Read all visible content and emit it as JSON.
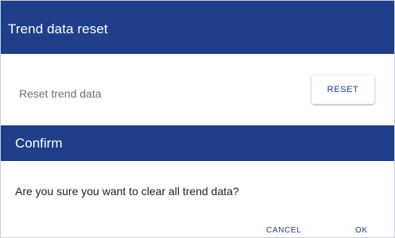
{
  "settings_panel": {
    "title": "Trend data reset",
    "row_label": "Reset trend data",
    "reset_button_label": "RESET"
  },
  "confirm_dialog": {
    "title": "Confirm",
    "message": "Are you sure you want to clear all trend data?",
    "cancel_label": "CANCEL",
    "ok_label": "OK"
  },
  "colors": {
    "header_bg": "#1f3f8a",
    "accent_text": "#1f3f8a",
    "header_text": "#ffffff"
  }
}
